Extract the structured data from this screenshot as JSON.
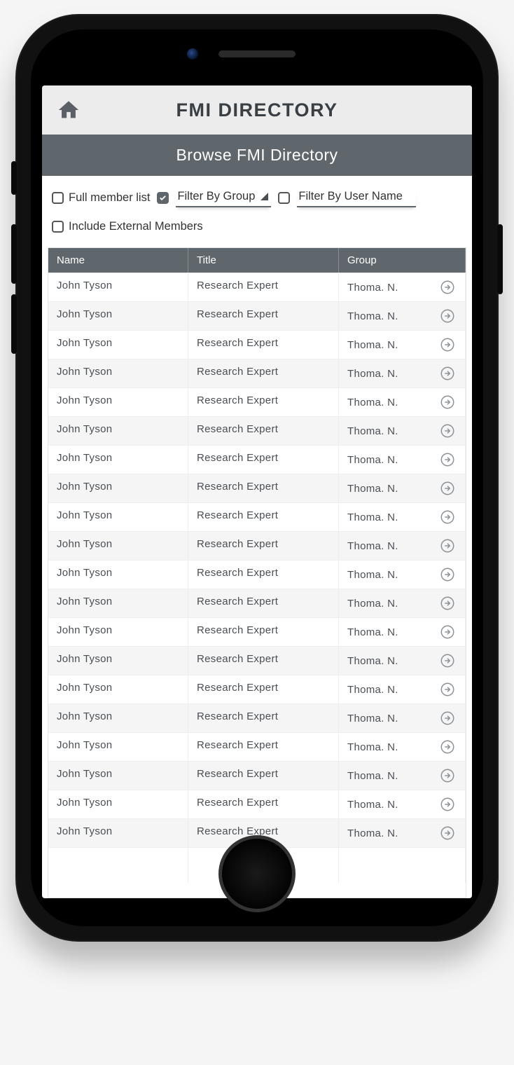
{
  "header": {
    "title": "FMI DIRECTORY"
  },
  "subheader": {
    "title": "Browse FMI Directory"
  },
  "filters": {
    "full_member_list": {
      "label": "Full member list",
      "checked": false
    },
    "filter_by_group": {
      "label": "Filter By Group",
      "checked": true
    },
    "filter_by_username": {
      "label": "Filter By User Name",
      "checked": false
    },
    "include_external": {
      "label": "Include External Members",
      "checked": false
    }
  },
  "table": {
    "columns": {
      "name": "Name",
      "title": "Title",
      "group": "Group"
    },
    "rows": [
      {
        "name": "John Tyson",
        "title": "Research Expert",
        "group": "Thoma. N."
      },
      {
        "name": "John Tyson",
        "title": "Research Expert",
        "group": "Thoma. N."
      },
      {
        "name": "John Tyson",
        "title": "Research Expert",
        "group": "Thoma. N."
      },
      {
        "name": "John Tyson",
        "title": "Research Expert",
        "group": "Thoma. N."
      },
      {
        "name": "John Tyson",
        "title": "Research Expert",
        "group": "Thoma. N."
      },
      {
        "name": "John Tyson",
        "title": "Research Expert",
        "group": "Thoma. N."
      },
      {
        "name": "John Tyson",
        "title": "Research Expert",
        "group": "Thoma. N."
      },
      {
        "name": "John Tyson",
        "title": "Research Expert",
        "group": "Thoma. N."
      },
      {
        "name": "John Tyson",
        "title": "Research Expert",
        "group": "Thoma. N."
      },
      {
        "name": "John Tyson",
        "title": "Research Expert",
        "group": "Thoma. N."
      },
      {
        "name": "John Tyson",
        "title": "Research Expert",
        "group": "Thoma. N."
      },
      {
        "name": "John Tyson",
        "title": "Research Expert",
        "group": "Thoma. N."
      },
      {
        "name": "John Tyson",
        "title": "Research Expert",
        "group": "Thoma. N."
      },
      {
        "name": "John Tyson",
        "title": "Research Expert",
        "group": "Thoma. N."
      },
      {
        "name": "John Tyson",
        "title": "Research Expert",
        "group": "Thoma. N."
      },
      {
        "name": "John Tyson",
        "title": "Research Expert",
        "group": "Thoma. N."
      },
      {
        "name": "John Tyson",
        "title": "Research Expert",
        "group": "Thoma. N."
      },
      {
        "name": "John Tyson",
        "title": "Research Expert",
        "group": "Thoma. N."
      },
      {
        "name": "John Tyson",
        "title": "Research Expert",
        "group": "Thoma. N."
      },
      {
        "name": "John Tyson",
        "title": "Research Expert",
        "group": "Thoma. N."
      }
    ]
  }
}
